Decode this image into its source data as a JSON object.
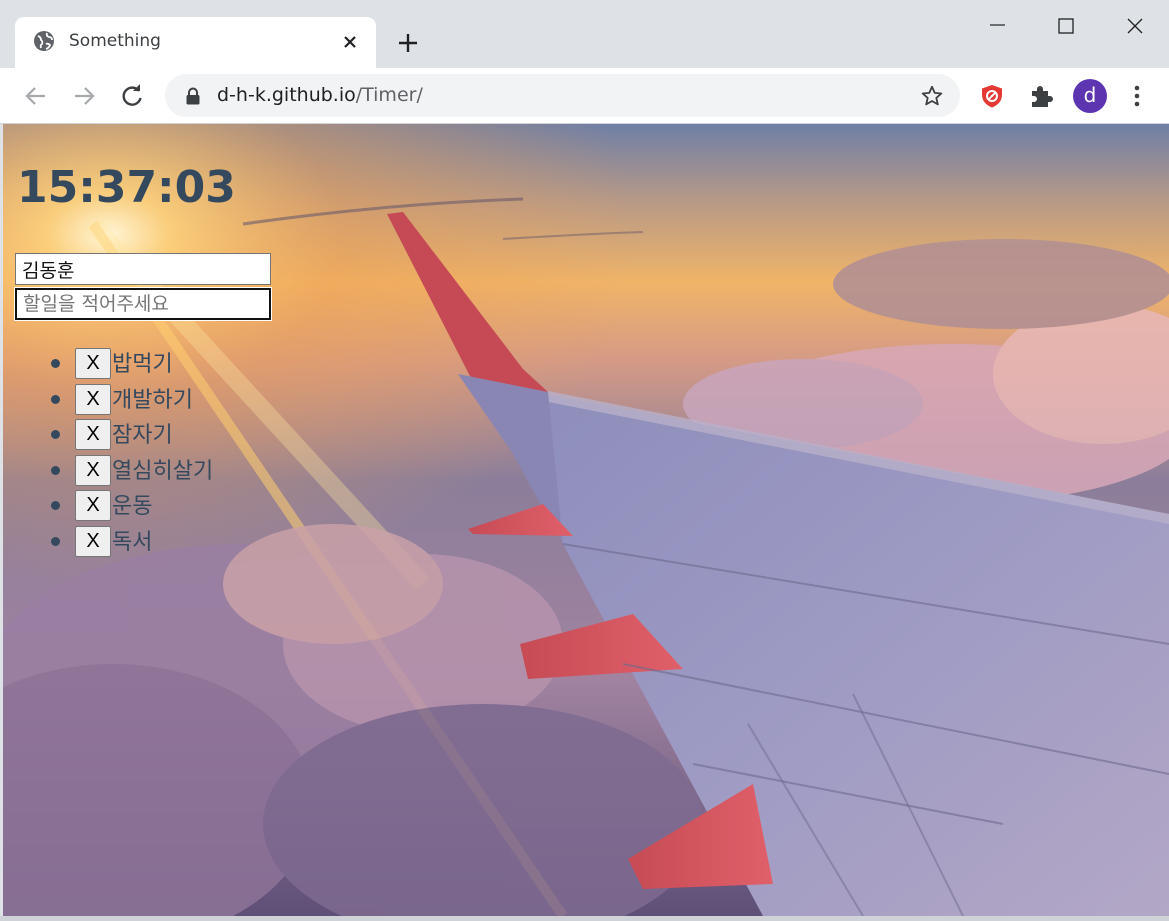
{
  "browser": {
    "tab_title": "Something",
    "url_host": "d-h-k.github.io",
    "url_path": "/Timer/",
    "profile_initial": "d"
  },
  "page": {
    "clock": "15:37:03",
    "name_value": "김동훈",
    "todo_placeholder": "할일을 적어주세요",
    "delete_label": "X",
    "todos": [
      "밥먹기",
      "개발하기",
      "잠자기",
      "열심히살기",
      "운동",
      "독서"
    ]
  },
  "colors": {
    "text": "#34495e",
    "avatar": "#5e35b1",
    "chrome_bg": "#dee1e6"
  }
}
